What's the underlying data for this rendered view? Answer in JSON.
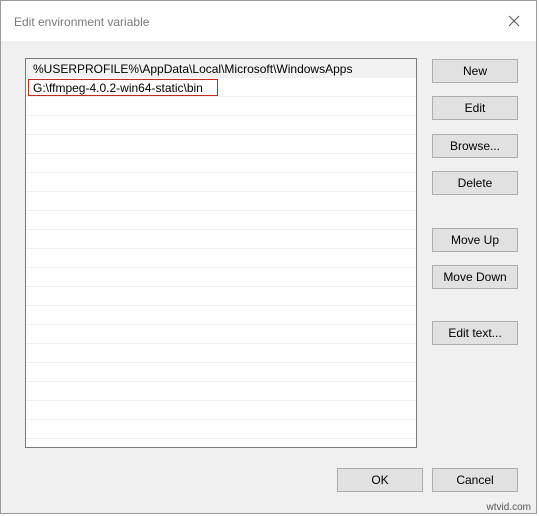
{
  "window": {
    "title": "Edit environment variable"
  },
  "list": {
    "items": [
      "%USERPROFILE%\\AppData\\Local\\Microsoft\\WindowsApps",
      "G:\\ffmpeg-4.0.2-win64-static\\bin"
    ],
    "editing_index": 1
  },
  "buttons": {
    "new": "New",
    "edit": "Edit",
    "browse": "Browse...",
    "delete": "Delete",
    "move_up": "Move Up",
    "move_down": "Move Down",
    "edit_text": "Edit text...",
    "ok": "OK",
    "cancel": "Cancel"
  },
  "icons": {
    "close": "close-icon"
  },
  "colors": {
    "edit_border": "#c42b1c",
    "button_face": "#e1e1e1",
    "window_bg": "#f0f0f0"
  },
  "watermark": "wtvid.com"
}
